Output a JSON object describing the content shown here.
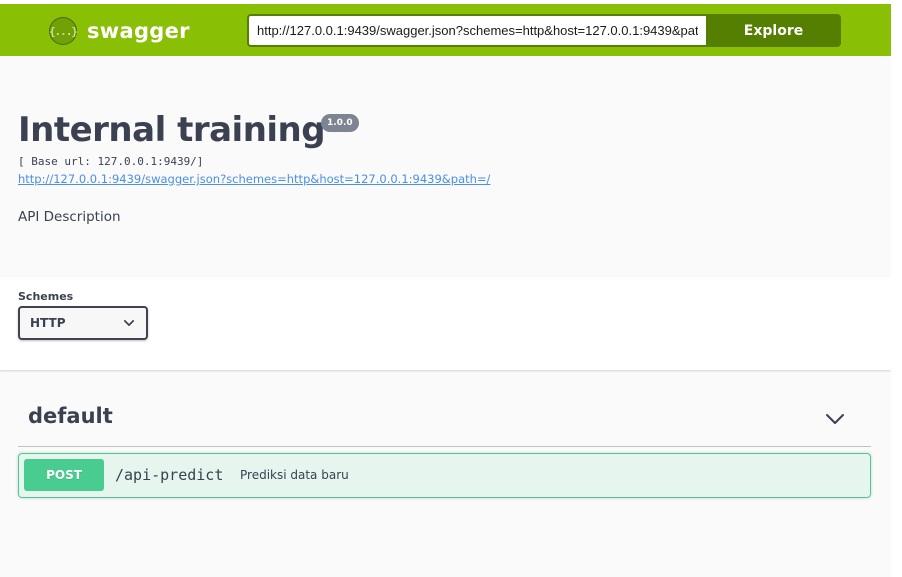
{
  "topbar": {
    "logo_glyph": "{...}",
    "brand": "swagger",
    "url_value": "http://127.0.0.1:9439/swagger.json?schemes=http&host=127.0.0.1:9439&path=/",
    "explore_label": "Explore",
    "colors": {
      "bar": "#89bf04",
      "button": "#547f00"
    }
  },
  "info": {
    "title": "Internal training",
    "version": "1.0.0",
    "base_url": "[ Base url: 127.0.0.1:9439/]",
    "spec_link": "http://127.0.0.1:9439/swagger.json?schemes=http&host=127.0.0.1:9439&path=/",
    "description": "API Description"
  },
  "schemes": {
    "label": "Schemes",
    "selected": "HTTP"
  },
  "tags": [
    {
      "name": "default",
      "operations": [
        {
          "method": "POST",
          "path": "/api-predict",
          "summary": "Prediksi data baru",
          "color": "#49cc90"
        }
      ]
    }
  ]
}
